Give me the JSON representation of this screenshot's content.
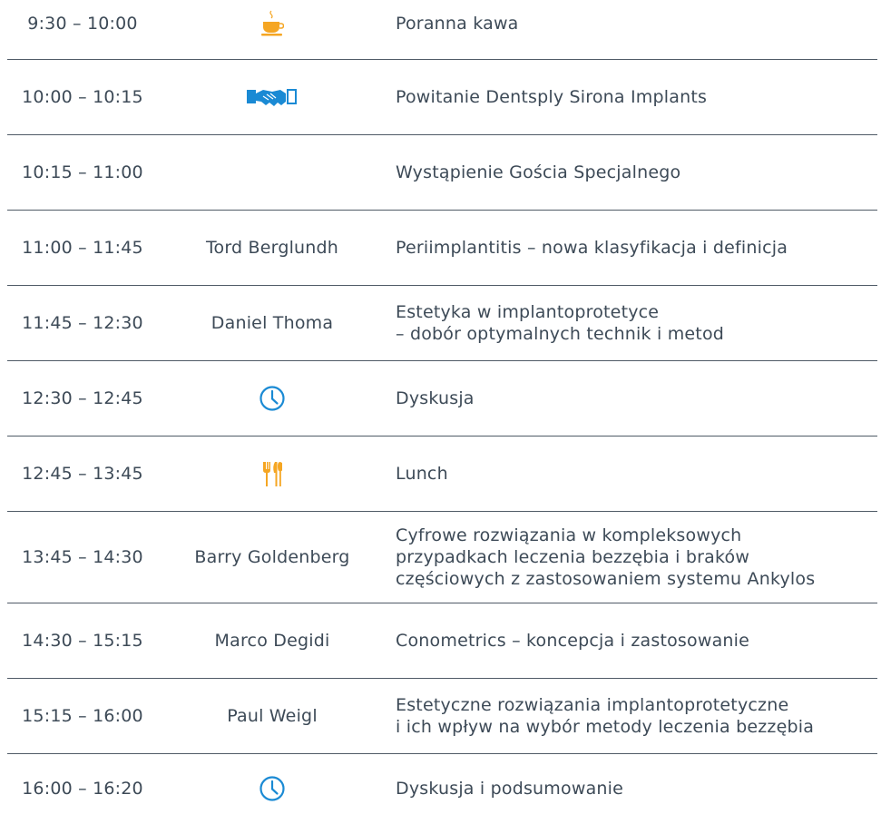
{
  "colors": {
    "text": "#3d4a57",
    "divider": "#4f5a66",
    "icon_orange": "#f5a623",
    "icon_blue": "#1a8ad4"
  },
  "rows": [
    {
      "time": "9:30 – 10:00",
      "speaker": "",
      "icon": "coffee-cup-icon",
      "topic": [
        "Poranna kawa"
      ]
    },
    {
      "time": "10:00 – 10:15",
      "speaker": "",
      "icon": "handshake-icon",
      "topic": [
        "Powitanie Dentsply Sirona Implants"
      ]
    },
    {
      "time": "10:15 – 11:00",
      "speaker": "",
      "icon": "",
      "topic": [
        "Wystąpienie Gościa Specjalnego"
      ]
    },
    {
      "time": "11:00 – 11:45",
      "speaker": "Tord Berglundh",
      "icon": "",
      "topic": [
        "Periimplantitis – nowa klasyfikacja i definicja"
      ]
    },
    {
      "time": "11:45 – 12:30",
      "speaker": "Daniel Thoma",
      "icon": "",
      "topic": [
        "Estetyka w implantoprotetyce",
        "– dobór optymalnych technik i metod"
      ]
    },
    {
      "time": "12:30 – 12:45",
      "speaker": "",
      "icon": "clock-icon",
      "topic": [
        "Dyskusja"
      ]
    },
    {
      "time": "12:45 – 13:45",
      "speaker": "",
      "icon": "fork-knife-icon",
      "topic": [
        "Lunch"
      ]
    },
    {
      "time": "13:45 – 14:30",
      "speaker": "Barry Goldenberg",
      "icon": "",
      "topic": [
        "Cyfrowe rozwiązania w kompleksowych",
        "przypadkach leczenia bezzębia i braków",
        "częściowych z zastosowaniem systemu Ankylos"
      ]
    },
    {
      "time": "14:30 – 15:15",
      "speaker": "Marco Degidi",
      "icon": "",
      "topic": [
        "Conometrics – koncepcja i zastosowanie"
      ]
    },
    {
      "time": "15:15 – 16:00",
      "speaker": "Paul Weigl",
      "icon": "",
      "topic": [
        "Estetyczne rozwiązania implantoprotetyczne",
        "i ich wpływ na wybór metody leczenia bezzębia"
      ]
    },
    {
      "time": "16:00 – 16:20",
      "speaker": "",
      "icon": "clock-icon",
      "topic": [
        "Dyskusja i podsumowanie"
      ]
    }
  ]
}
